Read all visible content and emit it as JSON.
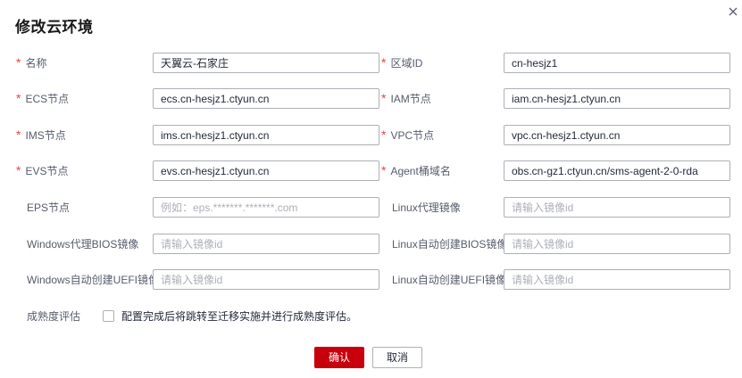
{
  "dialog": {
    "title": "修改云环境",
    "close_icon": "close-icon"
  },
  "left_fields": [
    {
      "label": "名称",
      "required": true,
      "value": "天翼云-石家庄",
      "placeholder": ""
    },
    {
      "label": "ECS节点",
      "required": true,
      "value": "ecs.cn-hesjz1.ctyun.cn",
      "placeholder": ""
    },
    {
      "label": "IMS节点",
      "required": true,
      "value": "ims.cn-hesjz1.ctyun.cn",
      "placeholder": ""
    },
    {
      "label": "EVS节点",
      "required": true,
      "value": "evs.cn-hesjz1.ctyun.cn",
      "placeholder": ""
    },
    {
      "label": "EPS节点",
      "required": false,
      "value": "",
      "placeholder": "例如：eps.*******.*******.com"
    },
    {
      "label": "Windows代理BIOS镜像",
      "required": false,
      "value": "",
      "placeholder": "请输入镜像id"
    },
    {
      "label": "Windows自动创建UEFI镜像",
      "required": false,
      "value": "",
      "placeholder": "请输入镜像id"
    }
  ],
  "right_fields": [
    {
      "label": "区域ID",
      "required": true,
      "value": "cn-hesjz1",
      "placeholder": ""
    },
    {
      "label": "IAM节点",
      "required": true,
      "value": "iam.cn-hesjz1.ctyun.cn",
      "placeholder": ""
    },
    {
      "label": "VPC节点",
      "required": true,
      "value": "vpc.cn-hesjz1.ctyun.cn",
      "placeholder": ""
    },
    {
      "label": "Agent桶域名",
      "required": true,
      "value": "obs.cn-gz1.ctyun.cn/sms-agent-2-0-rda",
      "placeholder": ""
    },
    {
      "label": "Linux代理镜像",
      "required": false,
      "value": "",
      "placeholder": "请输入镜像id"
    },
    {
      "label": "Linux自动创建BIOS镜像",
      "required": false,
      "value": "",
      "placeholder": "请输入镜像id"
    },
    {
      "label": "Linux自动创建UEFI镜像",
      "required": false,
      "value": "",
      "placeholder": "请输入镜像id"
    }
  ],
  "maturity": {
    "label": "成熟度评估",
    "checkbox_text": "配置完成后将跳转至迁移实施并进行成熟度评估。",
    "checked": false
  },
  "buttons": {
    "confirm": "确认",
    "cancel": "取消"
  },
  "colors": {
    "primary": "#c7000b",
    "required": "#e54545"
  }
}
